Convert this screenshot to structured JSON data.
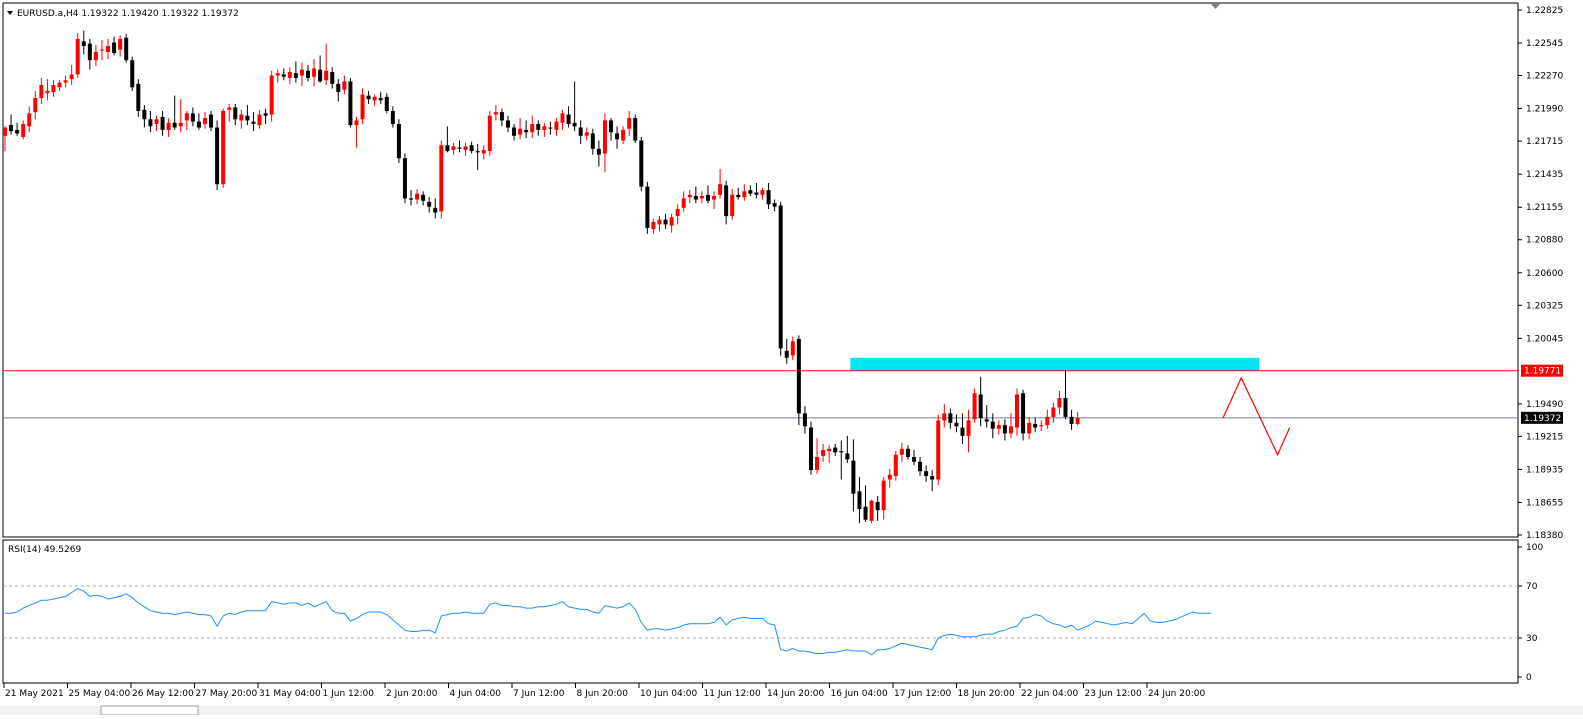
{
  "chart_data": {
    "type": "candlestick",
    "symbol_header": "EURUSD.a,H4  1.19322 1.19420 1.19322 1.19372",
    "price_axis": {
      "ticks": [
        "1.22825",
        "1.22545",
        "1.22270",
        "1.21990",
        "1.21715",
        "1.21435",
        "1.21155",
        "1.20880",
        "1.20600",
        "1.20325",
        "1.20045",
        "1.19490",
        "1.19215",
        "1.18935",
        "1.18655",
        "1.18380"
      ],
      "tick_values": [
        1.22825,
        1.22545,
        1.2227,
        1.2199,
        1.21715,
        1.21435,
        1.21155,
        1.2088,
        1.206,
        1.20325,
        1.20045,
        1.1949,
        1.19215,
        1.18935,
        1.18655,
        1.1838
      ],
      "range": [
        1.1838,
        1.22825
      ]
    },
    "time_axis": {
      "labels": [
        "21 May 2021",
        "25 May 04:00",
        "26 May 12:00",
        "27 May 20:00",
        "31 May 04:00",
        "1 Jun 12:00",
        "2 Jun 20:00",
        "4 Jun 04:00",
        "7 Jun 12:00",
        "8 Jun 20:00",
        "10 Jun 04:00",
        "11 Jun 12:00",
        "14 Jun 20:00",
        "16 Jun 04:00",
        "17 Jun 12:00",
        "18 Jun 20:00",
        "22 Jun 04:00",
        "23 Jun 12:00",
        "24 Jun 20:00"
      ]
    },
    "colors": {
      "bull": "#ff0000",
      "bear": "#000000",
      "rsi_line": "#1e90ff",
      "resistance_line": "#ff0000",
      "current_line": "#708090",
      "zone": "#00e5ee"
    },
    "resistance_level": {
      "value": 1.19771,
      "label": "1.19771"
    },
    "current_price": {
      "value": 1.19372,
      "label": "1.19372"
    },
    "supply_zone": {
      "price_low": 1.1977,
      "price_high": 1.1988,
      "from_candle": 140,
      "to_candle": 207
    },
    "projection_arrow": {
      "points": [
        [
          201,
          1.19372
        ],
        [
          204,
          1.1971
        ],
        [
          210,
          1.1906
        ],
        [
          212,
          1.1929
        ]
      ]
    },
    "candles": [
      [
        1.2176,
        1.2184,
        1.2163,
        1.2183
      ],
      [
        1.2185,
        1.2194,
        1.2177,
        1.218
      ],
      [
        1.2181,
        1.2187,
        1.2176,
        1.2178
      ],
      [
        1.2175,
        1.2189,
        1.2173,
        1.2186
      ],
      [
        1.2184,
        1.2201,
        1.2179,
        1.2195
      ],
      [
        1.2196,
        1.2214,
        1.219,
        1.2208
      ],
      [
        1.2208,
        1.2225,
        1.2203,
        1.2219
      ],
      [
        1.2212,
        1.2224,
        1.2206,
        1.2214
      ],
      [
        1.2213,
        1.2223,
        1.2209,
        1.2219
      ],
      [
        1.2217,
        1.2223,
        1.2214,
        1.2221
      ],
      [
        1.2221,
        1.2227,
        1.2217,
        1.2223
      ],
      [
        1.2224,
        1.2236,
        1.2219,
        1.2228
      ],
      [
        1.2228,
        1.2263,
        1.2225,
        1.2258
      ],
      [
        1.2256,
        1.2265,
        1.2245,
        1.2252
      ],
      [
        1.2254,
        1.2258,
        1.2232,
        1.224
      ],
      [
        1.224,
        1.2253,
        1.2235,
        1.2247
      ],
      [
        1.2249,
        1.2257,
        1.224,
        1.2249
      ],
      [
        1.2247,
        1.2258,
        1.2241,
        1.2252
      ],
      [
        1.2255,
        1.226,
        1.2244,
        1.2246
      ],
      [
        1.2249,
        1.2261,
        1.2243,
        1.2258
      ],
      [
        1.2259,
        1.2262,
        1.2238,
        1.224
      ],
      [
        1.224,
        1.2243,
        1.2214,
        1.2217
      ],
      [
        1.222,
        1.2224,
        1.2192,
        1.2197
      ],
      [
        1.2198,
        1.2202,
        1.2183,
        1.219
      ],
      [
        1.219,
        1.2197,
        1.2179,
        1.2184
      ],
      [
        1.2186,
        1.2193,
        1.218,
        1.219
      ],
      [
        1.2192,
        1.2197,
        1.2176,
        1.2181
      ],
      [
        1.2181,
        1.2191,
        1.2175,
        1.2187
      ],
      [
        1.2187,
        1.221,
        1.2181,
        1.2183
      ],
      [
        1.2184,
        1.2207,
        1.2179,
        1.2187
      ],
      [
        1.2189,
        1.2197,
        1.2181,
        1.2195
      ],
      [
        1.2195,
        1.22,
        1.2184,
        1.2188
      ],
      [
        1.2188,
        1.2195,
        1.2181,
        1.2183
      ],
      [
        1.2186,
        1.2196,
        1.2182,
        1.2191
      ],
      [
        1.2194,
        1.2197,
        1.218,
        1.2183
      ],
      [
        1.2183,
        1.2189,
        1.213,
        1.2135
      ],
      [
        1.2135,
        1.2199,
        1.2132,
        1.2197
      ],
      [
        1.2198,
        1.2203,
        1.2188,
        1.22
      ],
      [
        1.22,
        1.2203,
        1.2185,
        1.219
      ],
      [
        1.2189,
        1.2198,
        1.2182,
        1.2194
      ],
      [
        1.2193,
        1.2202,
        1.2185,
        1.2189
      ],
      [
        1.2188,
        1.2196,
        1.218,
        1.2186
      ],
      [
        1.2185,
        1.2198,
        1.2182,
        1.2194
      ],
      [
        1.2195,
        1.2199,
        1.2186,
        1.2193
      ],
      [
        1.2194,
        1.2231,
        1.2188,
        1.2227
      ],
      [
        1.2227,
        1.2232,
        1.2221,
        1.2229
      ],
      [
        1.2228,
        1.2233,
        1.2223,
        1.2226
      ],
      [
        1.2225,
        1.2234,
        1.222,
        1.223
      ],
      [
        1.2229,
        1.2239,
        1.2221,
        1.2225
      ],
      [
        1.2227,
        1.2238,
        1.2218,
        1.2232
      ],
      [
        1.2231,
        1.2236,
        1.2222,
        1.2225
      ],
      [
        1.2226,
        1.2241,
        1.2218,
        1.2233
      ],
      [
        1.2232,
        1.2244,
        1.2221,
        1.2222
      ],
      [
        1.2223,
        1.2254,
        1.2219,
        1.2231
      ],
      [
        1.223,
        1.2234,
        1.2216,
        1.222
      ],
      [
        1.222,
        1.2224,
        1.2205,
        1.2213
      ],
      [
        1.2215,
        1.2227,
        1.2211,
        1.2222
      ],
      [
        1.2222,
        1.2225,
        1.2183,
        1.2185
      ],
      [
        1.2185,
        1.2192,
        1.2166,
        1.2189
      ],
      [
        1.219,
        1.2216,
        1.2186,
        1.2211
      ],
      [
        1.221,
        1.2214,
        1.2203,
        1.2207
      ],
      [
        1.2206,
        1.2211,
        1.2201,
        1.2209
      ],
      [
        1.2208,
        1.2213,
        1.2203,
        1.2206
      ],
      [
        1.2209,
        1.2212,
        1.2195,
        1.2197
      ],
      [
        1.2197,
        1.2201,
        1.2183,
        1.2186
      ],
      [
        1.2186,
        1.219,
        1.2153,
        1.2157
      ],
      [
        1.2157,
        1.2161,
        1.2119,
        1.2123
      ],
      [
        1.2123,
        1.213,
        1.2117,
        1.2122
      ],
      [
        1.2122,
        1.2131,
        1.2118,
        1.2127
      ],
      [
        1.2126,
        1.2129,
        1.2117,
        1.2121
      ],
      [
        1.212,
        1.2124,
        1.2111,
        1.2116
      ],
      [
        1.2115,
        1.2123,
        1.2106,
        1.2111
      ],
      [
        1.2112,
        1.2172,
        1.2106,
        1.2168
      ],
      [
        1.2168,
        1.2184,
        1.2162,
        1.2163
      ],
      [
        1.2164,
        1.217,
        1.216,
        1.2167
      ],
      [
        1.2166,
        1.2172,
        1.2162,
        1.2165
      ],
      [
        1.2164,
        1.217,
        1.2159,
        1.2167
      ],
      [
        1.2168,
        1.2171,
        1.2161,
        1.2163
      ],
      [
        1.2163,
        1.2169,
        1.2147,
        1.2162
      ],
      [
        1.2161,
        1.2168,
        1.2156,
        1.2164
      ],
      [
        1.2163,
        1.2197,
        1.2159,
        1.2193
      ],
      [
        1.2194,
        1.2202,
        1.2189,
        1.2196
      ],
      [
        1.2196,
        1.2199,
        1.2184,
        1.2189
      ],
      [
        1.2189,
        1.2193,
        1.2179,
        1.2183
      ],
      [
        1.2183,
        1.2186,
        1.2172,
        1.2176
      ],
      [
        1.2177,
        1.2191,
        1.2173,
        1.2182
      ],
      [
        1.2181,
        1.2189,
        1.2174,
        1.2179
      ],
      [
        1.2179,
        1.2193,
        1.2174,
        1.2186
      ],
      [
        1.2186,
        1.2189,
        1.2176,
        1.2181
      ],
      [
        1.2181,
        1.2187,
        1.2175,
        1.2184
      ],
      [
        1.2183,
        1.2188,
        1.2177,
        1.2182
      ],
      [
        1.2181,
        1.2191,
        1.2176,
        1.2188
      ],
      [
        1.2187,
        1.2198,
        1.2181,
        1.2195
      ],
      [
        1.2194,
        1.2201,
        1.2183,
        1.2186
      ],
      [
        1.2187,
        1.2222,
        1.218,
        1.2184
      ],
      [
        1.2183,
        1.2189,
        1.2169,
        1.2176
      ],
      [
        1.2176,
        1.2183,
        1.2172,
        1.2179
      ],
      [
        1.2178,
        1.2182,
        1.216,
        1.2165
      ],
      [
        1.2165,
        1.2172,
        1.215,
        1.216
      ],
      [
        1.2161,
        1.2195,
        1.2145,
        1.2189
      ],
      [
        1.2189,
        1.2191,
        1.2172,
        1.2179
      ],
      [
        1.2178,
        1.2184,
        1.2165,
        1.2173
      ],
      [
        1.2172,
        1.2184,
        1.2169,
        1.2181
      ],
      [
        1.2182,
        1.2197,
        1.2176,
        1.2191
      ],
      [
        1.2191,
        1.2194,
        1.217,
        1.2172
      ],
      [
        1.2172,
        1.2175,
        1.2129,
        1.2133
      ],
      [
        1.2133,
        1.2137,
        1.2093,
        1.2098
      ],
      [
        1.2097,
        1.2106,
        1.2093,
        1.2103
      ],
      [
        1.2101,
        1.2108,
        1.2095,
        1.2105
      ],
      [
        1.2105,
        1.211,
        1.2097,
        1.2101
      ],
      [
        1.21,
        1.211,
        1.2094,
        1.2107
      ],
      [
        1.2108,
        1.2118,
        1.2101,
        1.2114
      ],
      [
        1.2115,
        1.2129,
        1.2112,
        1.2123
      ],
      [
        1.2124,
        1.213,
        1.2119,
        1.2126
      ],
      [
        1.2125,
        1.2133,
        1.2119,
        1.2122
      ],
      [
        1.2123,
        1.2129,
        1.2119,
        1.2125
      ],
      [
        1.2126,
        1.2134,
        1.2119,
        1.2121
      ],
      [
        1.2122,
        1.2129,
        1.2114,
        1.2125
      ],
      [
        1.2126,
        1.2148,
        1.2123,
        1.2135
      ],
      [
        1.2134,
        1.2138,
        1.2101,
        1.2108
      ],
      [
        1.2108,
        1.2131,
        1.2105,
        1.2126
      ],
      [
        1.2126,
        1.2132,
        1.2122,
        1.2124
      ],
      [
        1.2124,
        1.2135,
        1.2121,
        1.2129
      ],
      [
        1.213,
        1.2134,
        1.2125,
        1.2127
      ],
      [
        1.2128,
        1.2136,
        1.2123,
        1.2126
      ],
      [
        1.2126,
        1.2132,
        1.2122,
        1.213
      ],
      [
        1.213,
        1.2136,
        1.2114,
        1.2118
      ],
      [
        1.2119,
        1.2122,
        1.2112,
        1.2116
      ],
      [
        1.2117,
        1.212,
        1.199,
        1.1996
      ],
      [
        1.1994,
        1.2004,
        1.1983,
        1.1988
      ],
      [
        1.199,
        1.2006,
        1.1986,
        1.2002
      ],
      [
        1.2004,
        1.2007,
        1.1931,
        1.1941
      ],
      [
        1.1941,
        1.1947,
        1.1924,
        1.193
      ],
      [
        1.1929,
        1.1934,
        1.1889,
        1.1893
      ],
      [
        1.1893,
        1.192,
        1.189,
        1.1904
      ],
      [
        1.1905,
        1.1915,
        1.19,
        1.191
      ],
      [
        1.1909,
        1.1914,
        1.1899,
        1.1911
      ],
      [
        1.1912,
        1.1915,
        1.1905,
        1.1908
      ],
      [
        1.1909,
        1.1918,
        1.1885,
        1.1908
      ],
      [
        1.1907,
        1.1922,
        1.1899,
        1.1902
      ],
      [
        1.1901,
        1.1919,
        1.1858,
        1.1873
      ],
      [
        1.1875,
        1.1887,
        1.1848,
        1.186
      ],
      [
        1.1862,
        1.188,
        1.1849,
        1.1851
      ],
      [
        1.185,
        1.1868,
        1.1848,
        1.1867
      ],
      [
        1.1866,
        1.1871,
        1.185,
        1.1859
      ],
      [
        1.1859,
        1.1887,
        1.1851,
        1.1884
      ],
      [
        1.1885,
        1.1894,
        1.1878,
        1.1889
      ],
      [
        1.1888,
        1.1909,
        1.1884,
        1.1906
      ],
      [
        1.1906,
        1.1916,
        1.19,
        1.1911
      ],
      [
        1.1911,
        1.1914,
        1.1902,
        1.1904
      ],
      [
        1.1904,
        1.191,
        1.1897,
        1.19
      ],
      [
        1.19,
        1.1904,
        1.1888,
        1.1892
      ],
      [
        1.1892,
        1.1897,
        1.1883,
        1.1888
      ],
      [
        1.1888,
        1.1893,
        1.1875,
        1.1885
      ],
      [
        1.1885,
        1.194,
        1.188,
        1.1935
      ],
      [
        1.1935,
        1.1949,
        1.1929,
        1.1941
      ],
      [
        1.1941,
        1.1945,
        1.1928,
        1.1933
      ],
      [
        1.1933,
        1.194,
        1.1925,
        1.193
      ],
      [
        1.1929,
        1.1941,
        1.1915,
        1.1922
      ],
      [
        1.1922,
        1.1944,
        1.1908,
        1.1935
      ],
      [
        1.1936,
        1.1962,
        1.1933,
        1.1958
      ],
      [
        1.1957,
        1.1972,
        1.193,
        1.1937
      ],
      [
        1.1936,
        1.1948,
        1.1929,
        1.1934
      ],
      [
        1.1934,
        1.1941,
        1.192,
        1.1928
      ],
      [
        1.1928,
        1.1935,
        1.1923,
        1.1931
      ],
      [
        1.1931,
        1.1936,
        1.1918,
        1.1924
      ],
      [
        1.1924,
        1.1941,
        1.192,
        1.193
      ],
      [
        1.1929,
        1.1962,
        1.1922,
        1.1957
      ],
      [
        1.1958,
        1.1961,
        1.1918,
        1.1924
      ],
      [
        1.1924,
        1.1938,
        1.1919,
        1.1933
      ],
      [
        1.1932,
        1.1937,
        1.1925,
        1.1929
      ],
      [
        1.193,
        1.1935,
        1.1926,
        1.1931
      ],
      [
        1.1931,
        1.1944,
        1.1928,
        1.1938
      ],
      [
        1.1938,
        1.195,
        1.1933,
        1.1946
      ],
      [
        1.1946,
        1.196,
        1.194,
        1.1954
      ],
      [
        1.1954,
        1.1977,
        1.1936,
        1.1938
      ],
      [
        1.1938,
        1.1944,
        1.1927,
        1.1932
      ],
      [
        1.1932,
        1.1942,
        1.1931,
        1.1937
      ]
    ]
  },
  "rsi_panel": {
    "header": "RSI(14) 49.5269",
    "ticks": [
      "100",
      "70",
      "30",
      "0"
    ],
    "levels": [
      70,
      30
    ],
    "values": [
      49,
      49,
      50,
      53,
      55,
      57,
      59,
      59,
      60,
      61,
      62,
      65,
      68,
      66,
      62,
      63,
      62,
      60,
      61,
      62,
      64,
      61,
      57,
      54,
      51,
      50,
      49,
      49,
      48,
      49,
      50,
      49,
      48,
      48,
      47,
      39,
      47,
      49,
      48,
      50,
      51,
      51,
      51,
      51,
      58,
      57,
      56,
      57,
      57,
      55,
      57,
      54,
      56,
      58,
      51,
      49,
      49,
      43,
      45,
      48,
      50,
      50,
      50,
      48,
      44,
      40,
      36,
      35,
      35,
      36,
      36,
      34,
      47,
      48,
      49,
      49,
      50,
      49,
      49,
      49,
      56,
      57,
      55,
      55,
      54,
      54,
      53,
      53,
      54,
      54,
      55,
      56,
      58,
      54,
      53,
      52,
      52,
      50,
      49,
      55,
      54,
      53,
      54,
      57,
      52,
      42,
      36,
      37,
      37,
      36,
      37,
      38,
      40,
      41,
      41,
      41,
      41,
      42,
      46,
      40,
      44,
      45,
      46,
      45,
      45,
      45,
      41,
      40,
      21,
      20,
      22,
      20,
      20,
      19,
      18,
      18,
      19,
      19,
      20,
      21,
      20,
      20,
      20,
      17,
      21,
      21,
      22,
      24,
      26,
      25,
      24,
      23,
      22,
      21,
      30,
      32,
      33,
      32,
      31,
      31,
      31,
      32,
      33,
      33,
      35,
      36,
      38,
      39,
      45,
      46,
      48,
      47,
      43,
      41,
      40,
      38,
      40,
      36,
      38,
      40,
      43,
      42,
      41,
      40,
      41,
      42,
      41,
      45,
      49,
      43,
      42,
      42,
      43,
      44,
      46,
      48,
      50,
      49,
      49,
      49
    ]
  }
}
